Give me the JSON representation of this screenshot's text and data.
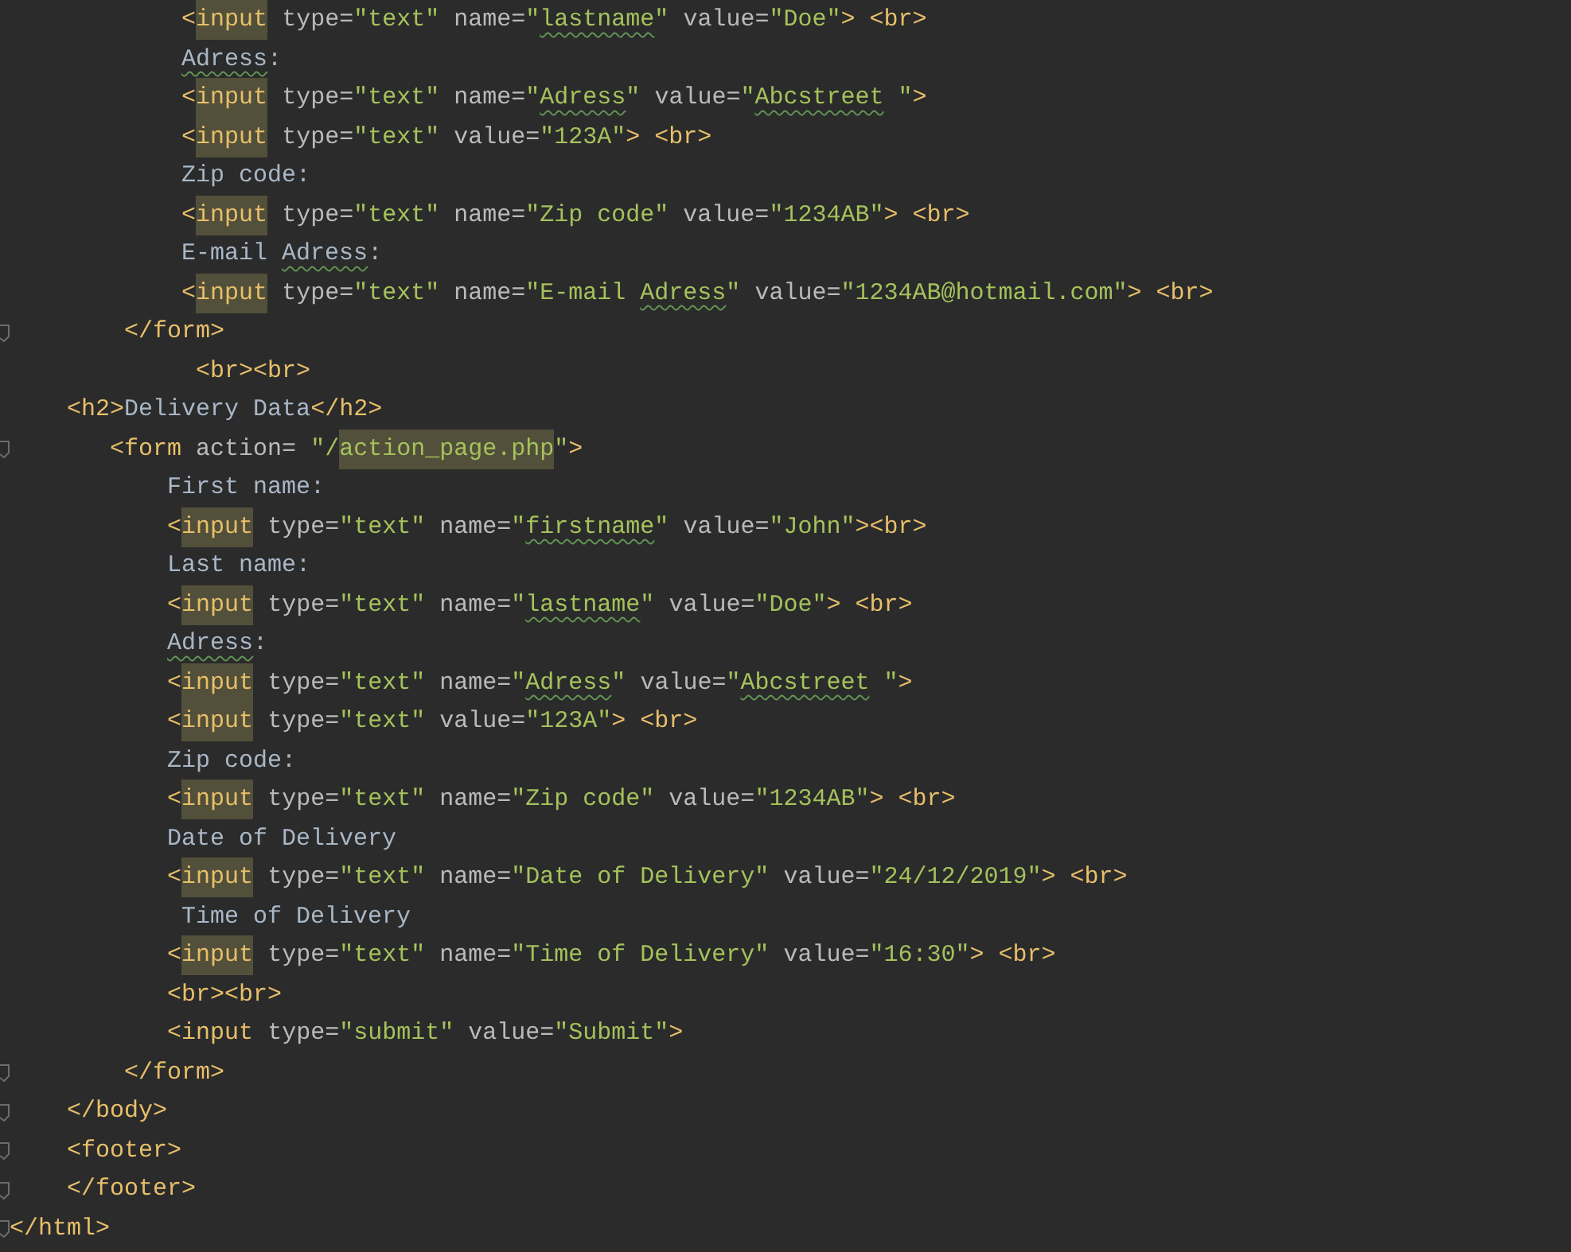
{
  "editor": {
    "lines": [
      {
        "fold": false,
        "tokens": [
          {
            "kind": "tag",
            "text": "            <"
          },
          {
            "kind": "tag_hl",
            "text": "input"
          },
          {
            "kind": "attr",
            "text": " type="
          },
          {
            "kind": "str",
            "text": "\"text\""
          },
          {
            "kind": "attr",
            "text": " name="
          },
          {
            "kind": "str",
            "text": "\""
          },
          {
            "kind": "str_typo",
            "text": "lastname"
          },
          {
            "kind": "str",
            "text": "\""
          },
          {
            "kind": "attr",
            "text": " value="
          },
          {
            "kind": "str",
            "text": "\"Doe\""
          },
          {
            "kind": "tag",
            "text": "> <br>"
          }
        ]
      },
      {
        "fold": false,
        "tokens": [
          {
            "kind": "text_typo",
            "text": "            Adress"
          },
          {
            "kind": "text",
            "text": ":"
          }
        ]
      },
      {
        "fold": false,
        "tokens": [
          {
            "kind": "tag",
            "text": "            <"
          },
          {
            "kind": "tag_hl",
            "text": "input"
          },
          {
            "kind": "attr",
            "text": " type="
          },
          {
            "kind": "str",
            "text": "\"text\""
          },
          {
            "kind": "attr",
            "text": " name="
          },
          {
            "kind": "str",
            "text": "\""
          },
          {
            "kind": "str_typo",
            "text": "Adress"
          },
          {
            "kind": "str",
            "text": "\""
          },
          {
            "kind": "attr",
            "text": " value="
          },
          {
            "kind": "str",
            "text": "\""
          },
          {
            "kind": "str_typo",
            "text": "Abcstreet"
          },
          {
            "kind": "str",
            "text": " \""
          },
          {
            "kind": "tag",
            "text": ">"
          }
        ]
      },
      {
        "fold": false,
        "tokens": [
          {
            "kind": "tag",
            "text": "            <"
          },
          {
            "kind": "tag_hl",
            "text": "input"
          },
          {
            "kind": "attr",
            "text": " type="
          },
          {
            "kind": "str",
            "text": "\"text\""
          },
          {
            "kind": "attr",
            "text": " value="
          },
          {
            "kind": "str",
            "text": "\"123A\""
          },
          {
            "kind": "tag",
            "text": "> <br>"
          }
        ]
      },
      {
        "fold": false,
        "tokens": [
          {
            "kind": "text",
            "text": "            Zip code:"
          }
        ]
      },
      {
        "fold": false,
        "tokens": [
          {
            "kind": "tag",
            "text": "            <"
          },
          {
            "kind": "tag_hl",
            "text": "input"
          },
          {
            "kind": "attr",
            "text": " type="
          },
          {
            "kind": "str",
            "text": "\"text\""
          },
          {
            "kind": "attr",
            "text": " name="
          },
          {
            "kind": "str",
            "text": "\"Zip code\""
          },
          {
            "kind": "attr",
            "text": " value="
          },
          {
            "kind": "str",
            "text": "\"1234AB\""
          },
          {
            "kind": "tag",
            "text": "> <br>"
          }
        ]
      },
      {
        "fold": false,
        "tokens": [
          {
            "kind": "text",
            "text": "            E-mail "
          },
          {
            "kind": "text_typo",
            "text": "Adress"
          },
          {
            "kind": "text",
            "text": ":"
          }
        ]
      },
      {
        "fold": false,
        "tokens": [
          {
            "kind": "tag",
            "text": "            <"
          },
          {
            "kind": "tag_hl",
            "text": "input"
          },
          {
            "kind": "attr",
            "text": " type="
          },
          {
            "kind": "str",
            "text": "\"text\""
          },
          {
            "kind": "attr",
            "text": " name="
          },
          {
            "kind": "str",
            "text": "\"E-mail "
          },
          {
            "kind": "str_typo",
            "text": "Adress"
          },
          {
            "kind": "str",
            "text": "\""
          },
          {
            "kind": "attr",
            "text": " value="
          },
          {
            "kind": "str",
            "text": "\"1234AB@hotmail.com\""
          },
          {
            "kind": "tag",
            "text": "> <br>"
          }
        ]
      },
      {
        "fold": true,
        "tokens": [
          {
            "kind": "tag",
            "text": "        </form>"
          }
        ]
      },
      {
        "fold": false,
        "tokens": [
          {
            "kind": "tag",
            "text": "             <br><br>"
          }
        ]
      },
      {
        "fold": false,
        "tokens": [
          {
            "kind": "tag",
            "text": "    <h2>"
          },
          {
            "kind": "text",
            "text": "Delivery Data"
          },
          {
            "kind": "tag",
            "text": "</h2>"
          }
        ]
      },
      {
        "fold": true,
        "tokens": [
          {
            "kind": "tag",
            "text": "       <form"
          },
          {
            "kind": "attr",
            "text": " action= "
          },
          {
            "kind": "str",
            "text": "\"/"
          },
          {
            "kind": "str_hl",
            "text": "action_page.php"
          },
          {
            "kind": "str",
            "text": "\""
          },
          {
            "kind": "tag",
            "text": ">"
          }
        ]
      },
      {
        "fold": false,
        "tokens": [
          {
            "kind": "text",
            "text": "           First name:"
          }
        ]
      },
      {
        "fold": false,
        "tokens": [
          {
            "kind": "tag",
            "text": "           <"
          },
          {
            "kind": "tag_hl",
            "text": "input"
          },
          {
            "kind": "attr",
            "text": " type="
          },
          {
            "kind": "str",
            "text": "\"text\""
          },
          {
            "kind": "attr",
            "text": " name="
          },
          {
            "kind": "str",
            "text": "\""
          },
          {
            "kind": "str_typo",
            "text": "firstname"
          },
          {
            "kind": "str",
            "text": "\""
          },
          {
            "kind": "attr",
            "text": " value="
          },
          {
            "kind": "str",
            "text": "\"John\""
          },
          {
            "kind": "tag",
            "text": "><br>"
          }
        ]
      },
      {
        "fold": false,
        "tokens": [
          {
            "kind": "text",
            "text": "           Last name:"
          }
        ]
      },
      {
        "fold": false,
        "tokens": [
          {
            "kind": "tag",
            "text": "           <"
          },
          {
            "kind": "tag_hl",
            "text": "input"
          },
          {
            "kind": "attr",
            "text": " type="
          },
          {
            "kind": "str",
            "text": "\"text\""
          },
          {
            "kind": "attr",
            "text": " name="
          },
          {
            "kind": "str",
            "text": "\""
          },
          {
            "kind": "str_typo",
            "text": "lastname"
          },
          {
            "kind": "str",
            "text": "\""
          },
          {
            "kind": "attr",
            "text": " value="
          },
          {
            "kind": "str",
            "text": "\"Doe\""
          },
          {
            "kind": "tag",
            "text": "> <br>"
          }
        ]
      },
      {
        "fold": false,
        "tokens": [
          {
            "kind": "text_typo",
            "text": "           Adress"
          },
          {
            "kind": "text",
            "text": ":"
          }
        ]
      },
      {
        "fold": false,
        "tokens": [
          {
            "kind": "tag",
            "text": "           <"
          },
          {
            "kind": "tag_hl",
            "text": "input"
          },
          {
            "kind": "attr",
            "text": " type="
          },
          {
            "kind": "str",
            "text": "\"text\""
          },
          {
            "kind": "attr",
            "text": " name="
          },
          {
            "kind": "str",
            "text": "\""
          },
          {
            "kind": "str_typo",
            "text": "Adress"
          },
          {
            "kind": "str",
            "text": "\""
          },
          {
            "kind": "attr",
            "text": " value="
          },
          {
            "kind": "str",
            "text": "\""
          },
          {
            "kind": "str_typo",
            "text": "Abcstreet"
          },
          {
            "kind": "str",
            "text": " \""
          },
          {
            "kind": "tag",
            "text": ">"
          }
        ]
      },
      {
        "fold": false,
        "tokens": [
          {
            "kind": "tag",
            "text": "           <"
          },
          {
            "kind": "tag_hl",
            "text": "input"
          },
          {
            "kind": "attr",
            "text": " type="
          },
          {
            "kind": "str",
            "text": "\"text\""
          },
          {
            "kind": "attr",
            "text": " value="
          },
          {
            "kind": "str",
            "text": "\"123A\""
          },
          {
            "kind": "tag",
            "text": "> <br>"
          }
        ]
      },
      {
        "fold": false,
        "tokens": [
          {
            "kind": "text",
            "text": "           Zip code:"
          }
        ]
      },
      {
        "fold": false,
        "tokens": [
          {
            "kind": "tag",
            "text": "           <"
          },
          {
            "kind": "tag_hl",
            "text": "input"
          },
          {
            "kind": "attr",
            "text": " type="
          },
          {
            "kind": "str",
            "text": "\"text\""
          },
          {
            "kind": "attr",
            "text": " name="
          },
          {
            "kind": "str",
            "text": "\"Zip code\""
          },
          {
            "kind": "attr",
            "text": " value="
          },
          {
            "kind": "str",
            "text": "\"1234AB\""
          },
          {
            "kind": "tag",
            "text": "> <br>"
          }
        ]
      },
      {
        "fold": false,
        "tokens": [
          {
            "kind": "text",
            "text": "           Date of Delivery"
          }
        ]
      },
      {
        "fold": false,
        "tokens": [
          {
            "kind": "tag",
            "text": "           <"
          },
          {
            "kind": "tag_hl",
            "text": "input"
          },
          {
            "kind": "attr",
            "text": " type="
          },
          {
            "kind": "str",
            "text": "\"text\""
          },
          {
            "kind": "attr",
            "text": " name="
          },
          {
            "kind": "str",
            "text": "\"Date of Delivery\""
          },
          {
            "kind": "attr",
            "text": " value="
          },
          {
            "kind": "str",
            "text": "\"24/12/2019\""
          },
          {
            "kind": "tag",
            "text": "> <br>"
          }
        ]
      },
      {
        "fold": false,
        "tokens": [
          {
            "kind": "text",
            "text": "            Time of Delivery"
          }
        ]
      },
      {
        "fold": false,
        "tokens": [
          {
            "kind": "tag",
            "text": "           <"
          },
          {
            "kind": "tag_hl",
            "text": "input"
          },
          {
            "kind": "attr",
            "text": " type="
          },
          {
            "kind": "str",
            "text": "\"text\""
          },
          {
            "kind": "attr",
            "text": " name="
          },
          {
            "kind": "str",
            "text": "\"Time of Delivery\""
          },
          {
            "kind": "attr",
            "text": " value="
          },
          {
            "kind": "str",
            "text": "\"16:30\""
          },
          {
            "kind": "tag",
            "text": "> <br>"
          }
        ]
      },
      {
        "fold": false,
        "tokens": [
          {
            "kind": "tag",
            "text": "           <br><br>"
          }
        ]
      },
      {
        "fold": false,
        "tokens": [
          {
            "kind": "tag",
            "text": "           <input"
          },
          {
            "kind": "attr",
            "text": " type="
          },
          {
            "kind": "str",
            "text": "\"submit\""
          },
          {
            "kind": "attr",
            "text": " value="
          },
          {
            "kind": "str",
            "text": "\"Submit\""
          },
          {
            "kind": "tag",
            "text": ">"
          }
        ]
      },
      {
        "fold": true,
        "tokens": [
          {
            "kind": "tag",
            "text": "        </form>"
          }
        ]
      },
      {
        "fold": true,
        "tokens": [
          {
            "kind": "tag",
            "text": "    </body>"
          }
        ]
      },
      {
        "fold": true,
        "tokens": [
          {
            "kind": "tag",
            "text": "    <footer>"
          }
        ]
      },
      {
        "fold": true,
        "tokens": [
          {
            "kind": "tag",
            "text": "    </footer>"
          }
        ]
      },
      {
        "fold": true,
        "tokens": [
          {
            "kind": "tag",
            "text": "</html>"
          }
        ]
      }
    ]
  }
}
